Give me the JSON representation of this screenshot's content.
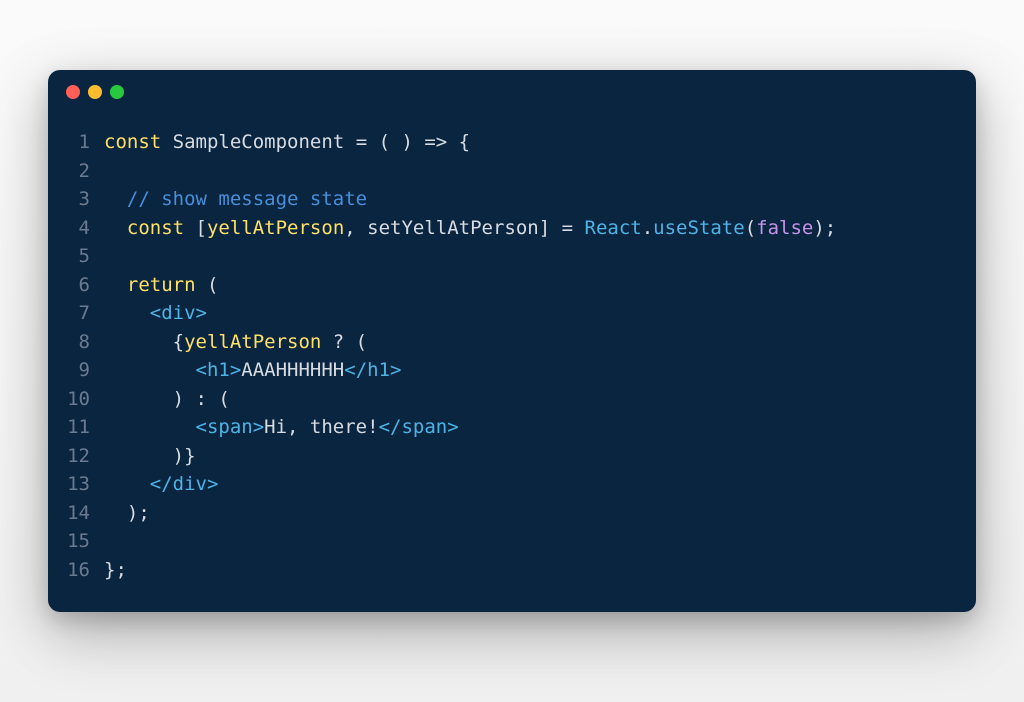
{
  "window": {
    "traffic_lights": [
      "red",
      "yellow",
      "green"
    ]
  },
  "code": {
    "lines": [
      {
        "num": "1",
        "tokens": [
          {
            "t": "const",
            "c": "tok-keyword"
          },
          {
            "t": " ",
            "c": "tok-ident"
          },
          {
            "t": "SampleComponent",
            "c": "tok-ident"
          },
          {
            "t": " = ( ) => {",
            "c": "tok-punct"
          }
        ]
      },
      {
        "num": "2",
        "tokens": []
      },
      {
        "num": "3",
        "tokens": [
          {
            "t": "  ",
            "c": "tok-ident"
          },
          {
            "t": "// show message state",
            "c": "tok-comment"
          }
        ]
      },
      {
        "num": "4",
        "tokens": [
          {
            "t": "  ",
            "c": "tok-ident"
          },
          {
            "t": "const",
            "c": "tok-keyword"
          },
          {
            "t": " [",
            "c": "tok-punct"
          },
          {
            "t": "yellAtPerson",
            "c": "tok-var"
          },
          {
            "t": ", ",
            "c": "tok-punct"
          },
          {
            "t": "setYellAtPerson",
            "c": "tok-ident"
          },
          {
            "t": "] = ",
            "c": "tok-punct"
          },
          {
            "t": "React",
            "c": "tok-class"
          },
          {
            "t": ".",
            "c": "tok-punct"
          },
          {
            "t": "useState",
            "c": "tok-method"
          },
          {
            "t": "(",
            "c": "tok-punct"
          },
          {
            "t": "false",
            "c": "tok-bool"
          },
          {
            "t": ");",
            "c": "tok-punct"
          }
        ]
      },
      {
        "num": "5",
        "tokens": []
      },
      {
        "num": "6",
        "tokens": [
          {
            "t": "  ",
            "c": "tok-ident"
          },
          {
            "t": "return",
            "c": "tok-keyword"
          },
          {
            "t": " (",
            "c": "tok-punct"
          }
        ]
      },
      {
        "num": "7",
        "tokens": [
          {
            "t": "    <",
            "c": "tok-tagbr"
          },
          {
            "t": "div",
            "c": "tok-tag"
          },
          {
            "t": ">",
            "c": "tok-tagbr"
          }
        ]
      },
      {
        "num": "8",
        "tokens": [
          {
            "t": "      {",
            "c": "tok-punct"
          },
          {
            "t": "yellAtPerson",
            "c": "tok-var"
          },
          {
            "t": " ? (",
            "c": "tok-punct"
          }
        ]
      },
      {
        "num": "9",
        "tokens": [
          {
            "t": "        <",
            "c": "tok-tagbr"
          },
          {
            "t": "h1",
            "c": "tok-tag"
          },
          {
            "t": ">",
            "c": "tok-tagbr"
          },
          {
            "t": "AAAHHHHHH",
            "c": "tok-string"
          },
          {
            "t": "</",
            "c": "tok-tagbr"
          },
          {
            "t": "h1",
            "c": "tok-tag"
          },
          {
            "t": ">",
            "c": "tok-tagbr"
          }
        ]
      },
      {
        "num": "10",
        "tokens": [
          {
            "t": "      ) : (",
            "c": "tok-punct"
          }
        ]
      },
      {
        "num": "11",
        "tokens": [
          {
            "t": "        <",
            "c": "tok-tagbr"
          },
          {
            "t": "span",
            "c": "tok-tag"
          },
          {
            "t": ">",
            "c": "tok-tagbr"
          },
          {
            "t": "Hi, there!",
            "c": "tok-string"
          },
          {
            "t": "</",
            "c": "tok-tagbr"
          },
          {
            "t": "span",
            "c": "tok-tag"
          },
          {
            "t": ">",
            "c": "tok-tagbr"
          }
        ]
      },
      {
        "num": "12",
        "tokens": [
          {
            "t": "      )}",
            "c": "tok-punct"
          }
        ]
      },
      {
        "num": "13",
        "tokens": [
          {
            "t": "    </",
            "c": "tok-tagbr"
          },
          {
            "t": "div",
            "c": "tok-tag"
          },
          {
            "t": ">",
            "c": "tok-tagbr"
          }
        ]
      },
      {
        "num": "14",
        "tokens": [
          {
            "t": "  );",
            "c": "tok-punct"
          }
        ]
      },
      {
        "num": "15",
        "tokens": []
      },
      {
        "num": "16",
        "tokens": [
          {
            "t": "};",
            "c": "tok-punct"
          }
        ]
      }
    ]
  }
}
